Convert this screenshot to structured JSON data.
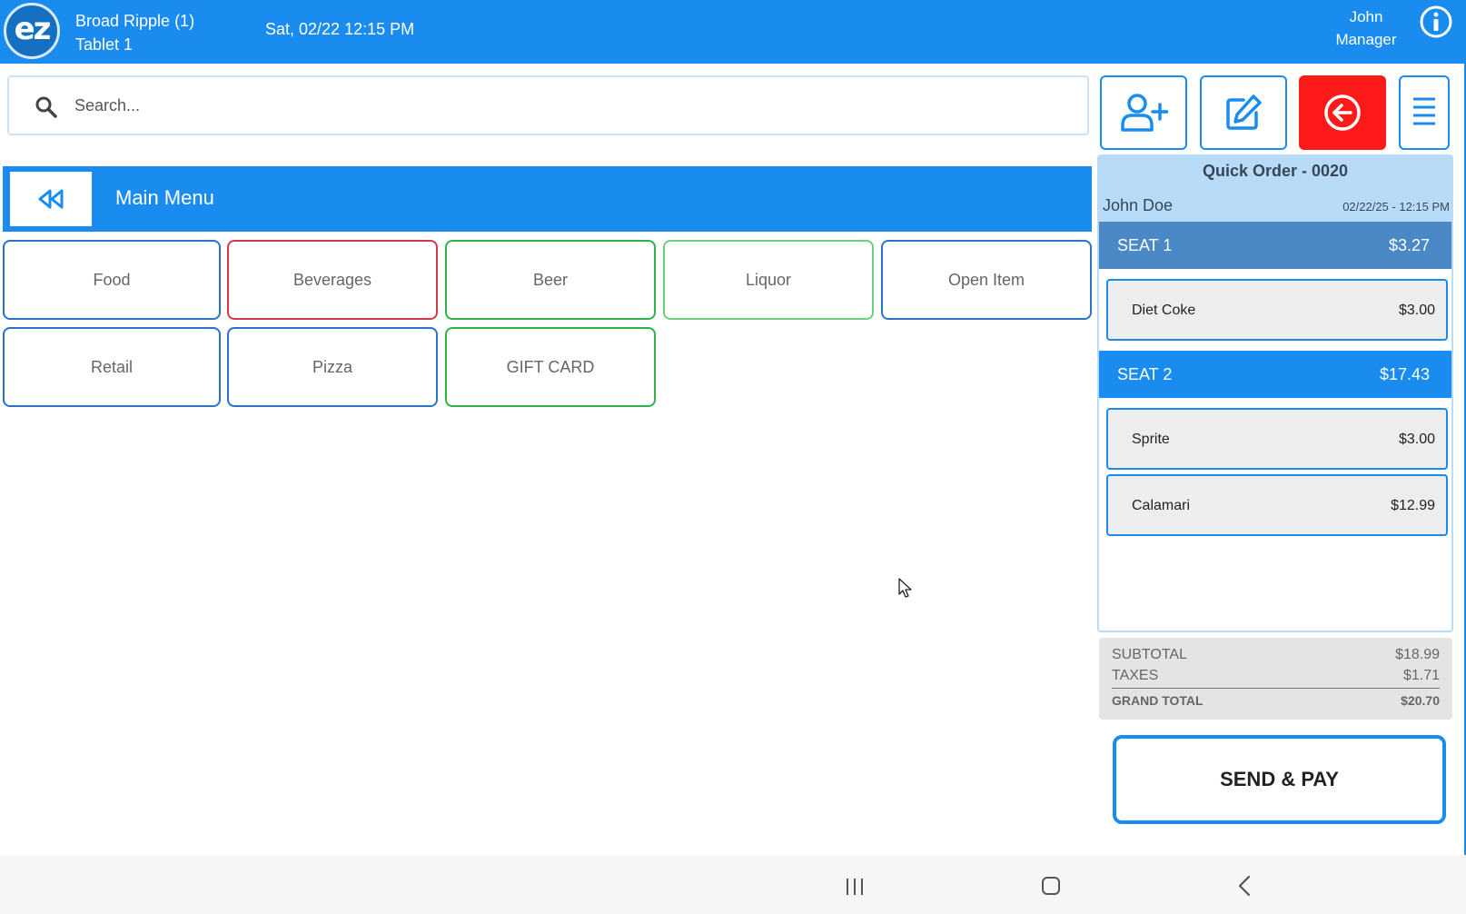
{
  "header": {
    "logo_text": "ez",
    "location": "Broad Ripple (1)",
    "device": "Tablet 1",
    "datetime": "Sat, 02/22 12:15 PM",
    "user_name": "John",
    "user_role": "Manager",
    "icons": [
      "ez-logo-icon",
      "info-icon"
    ],
    "bg_color": "#1a8cf0"
  },
  "search": {
    "placeholder": "Search...",
    "value": ""
  },
  "actions": [
    {
      "name": "add-customer-button",
      "icon": "user-plus-icon"
    },
    {
      "name": "edit-button",
      "icon": "edit-icon"
    },
    {
      "name": "back-exit-button",
      "icon": "arrow-left-circle-icon",
      "color": "#ff1a1a"
    },
    {
      "name": "menu-button",
      "icon": "hamburger-icon"
    }
  ],
  "menu": {
    "title": "Main Menu",
    "back_icon": "rewind-icon"
  },
  "categories": [
    {
      "label": "Food",
      "color": "#2a72c8"
    },
    {
      "label": "Beverages",
      "color": "#d23a4a"
    },
    {
      "label": "Beer",
      "color": "#2fb34a"
    },
    {
      "label": "Liquor",
      "color": "#6cd07a"
    },
    {
      "label": "Open Item",
      "color": "#2a72c8"
    },
    {
      "label": "Retail",
      "color": "#2a72c8"
    },
    {
      "label": "Pizza",
      "color": "#2a72c8"
    },
    {
      "label": "GIFT CARD",
      "color": "#2fb34a"
    }
  ],
  "order": {
    "title": "Quick Order - 0020",
    "customer": "John Doe",
    "date": "02/22/25 - 12:15 PM",
    "seats": [
      {
        "label": "SEAT 1",
        "total": "$3.27",
        "color": "#4a88c6",
        "items": [
          {
            "name": "Diet Coke",
            "price": "$3.00"
          }
        ]
      },
      {
        "label": "SEAT 2",
        "total": "$17.43",
        "color": "#1a8cf0",
        "items": [
          {
            "name": "Sprite",
            "price": "$3.00"
          },
          {
            "name": "Calamari",
            "price": "$12.99"
          }
        ]
      }
    ]
  },
  "totals": {
    "subtotal_label": "SUBTOTAL",
    "subtotal": "$18.99",
    "taxes_label": "TAXES",
    "taxes": "$1.71",
    "grand_label": "GRAND TOTAL",
    "grand": "$20.70"
  },
  "send_pay_label": "SEND & PAY",
  "android_nav": [
    "recent-apps-icon",
    "home-icon",
    "back-icon"
  ]
}
